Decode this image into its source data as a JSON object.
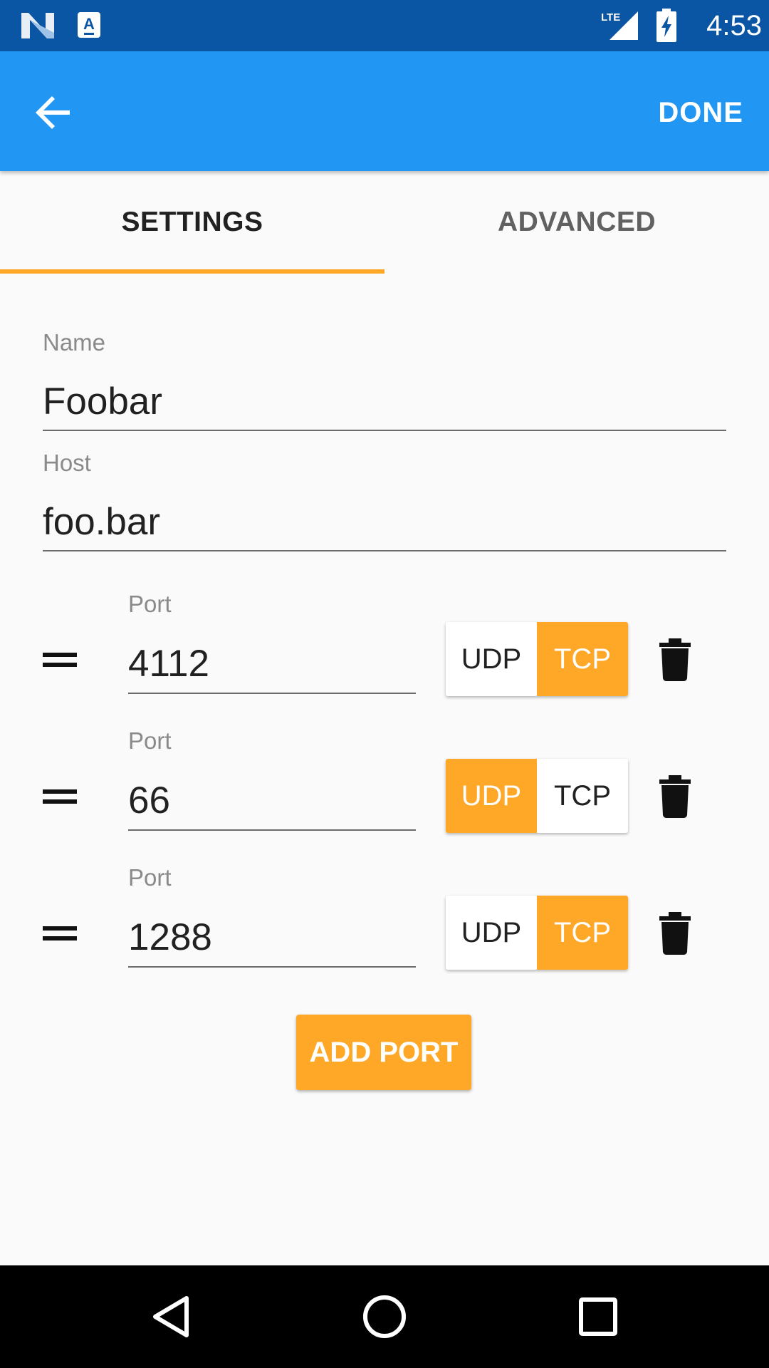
{
  "status_bar": {
    "time": "4:53",
    "network_label": "LTE",
    "icons": [
      "notification-n-icon",
      "notification-a-icon",
      "lte-signal-icon",
      "battery-charging-icon"
    ]
  },
  "app_bar": {
    "back_icon": "arrow-back-icon",
    "done_label": "DONE",
    "color": "#2196f3"
  },
  "tabs": [
    {
      "label": "SETTINGS",
      "selected": true
    },
    {
      "label": "ADVANCED",
      "selected": false
    }
  ],
  "accent_color": "#ffa726",
  "form": {
    "name": {
      "label": "Name",
      "value": "Foobar"
    },
    "host": {
      "label": "Host",
      "value": "foo.bar"
    }
  },
  "ports": [
    {
      "label": "Port",
      "value": "4112",
      "protocol": "TCP"
    },
    {
      "label": "Port",
      "value": "66",
      "protocol": "UDP"
    },
    {
      "label": "Port",
      "value": "1288",
      "protocol": "TCP"
    }
  ],
  "protocol_options": [
    "UDP",
    "TCP"
  ],
  "add_port_label": "ADD PORT",
  "nav_bar": {
    "buttons": [
      "nav-back-icon",
      "nav-home-icon",
      "nav-recents-icon"
    ]
  }
}
